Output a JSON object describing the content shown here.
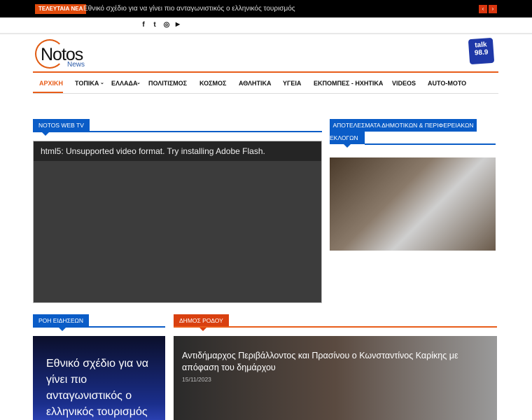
{
  "ticker": {
    "label": "ΤΕΛΕΥΤΑΙΑ ΝΕΑ",
    "headline": "Εθνικό σχέδιο για να γίνει πιο ανταγωνιστικός ο ελληνικός τουρισμός",
    "prev": "‹",
    "next": "›"
  },
  "social": {
    "facebook": "f",
    "twitter": "t",
    "instagram": "◎",
    "youtube": "▶"
  },
  "logo": {
    "name": "Notos",
    "sub": "News"
  },
  "radio": {
    "line1": "talk",
    "line2": "98.9"
  },
  "nav": [
    "ΑΡΧΙΚΗ",
    "ΤΟΠΙΚΑ",
    "ΕΛΛΑΔΑ",
    "ΠΟΛΙΤΙΣΜΟΣ",
    "ΚΟΣΜΟΣ",
    "ΑΘΛΗΤΙΚΑ",
    "ΥΓΕΙΑ",
    "ΕΚΠΟΜΠΕΣ - ΗΧΗΤΙΚΑ",
    "VIDEOS",
    "AUTO-MOTO"
  ],
  "colors": {
    "accent": "#e85d1a",
    "blue": "#0a5cc7"
  },
  "webtv": {
    "title": "NOTOS WEB TV",
    "message": "html5: Unsupported video format. Try installing Adobe Flash."
  },
  "elections": {
    "title_line1": "ΑΠΟΤΕΛΕΣΜΑΤΑ ΔΗΜΟΤΙΚΩΝ & ΠΕΡΙΦΕΡΕΙΑΚΩΝ",
    "title_line2": "ΕΚΛΟΓΩΝ"
  },
  "feed": {
    "title": "ΡΟΗ ΕΙΔΗΣΕΩΝ",
    "headline": "Εθνικό σχέδιο για να γίνει πιο ανταγωνιστικός ο ελληνικός τουρισμός"
  },
  "rhodes": {
    "title": "ΔΗΜΟΣ ΡΟΔΟΥ",
    "headline": "Αντιδήμαρχος Περιβάλλοντος και Πρασίνου ο Κωνσταντίνος Καρίκης με απόφαση του δημάρχου",
    "date": "15/11/2023"
  }
}
